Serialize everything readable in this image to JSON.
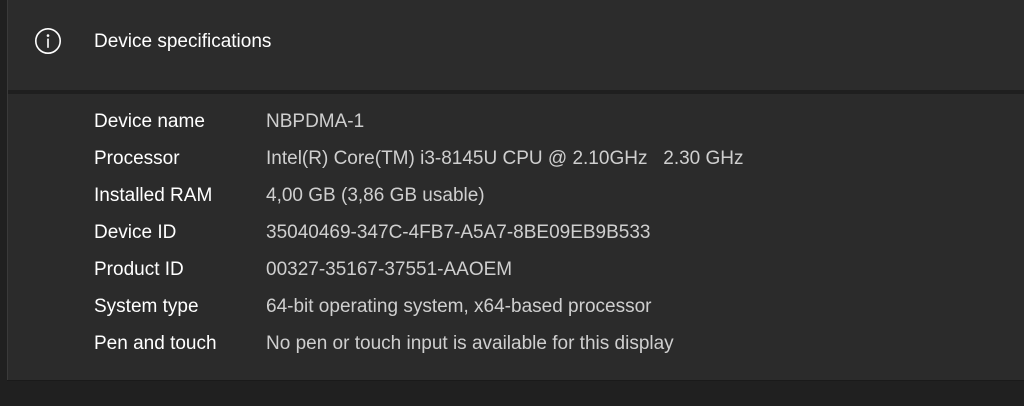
{
  "section": {
    "title": "Device specifications",
    "icon": "info-icon"
  },
  "specs": [
    {
      "label": "Device name",
      "value": "NBPDMA-1"
    },
    {
      "label": "Processor",
      "value": "Intel(R) Core(TM) i3-8145U CPU @ 2.10GHz   2.30 GHz"
    },
    {
      "label": "Installed RAM",
      "value": "4,00 GB (3,86 GB usable)"
    },
    {
      "label": "Device ID",
      "value": "35040469-347C-4FB7-A5A7-8BE09EB9B533"
    },
    {
      "label": "Product ID",
      "value": "00327-35167-37551-AAOEM"
    },
    {
      "label": "System type",
      "value": "64-bit operating system, x64-based processor"
    },
    {
      "label": "Pen and touch",
      "value": "No pen or touch input is available for this display"
    }
  ],
  "colors": {
    "background": "#202020",
    "card": "#2b2b2b",
    "label_text": "#ffffff",
    "value_text": "#cfcfcf"
  }
}
